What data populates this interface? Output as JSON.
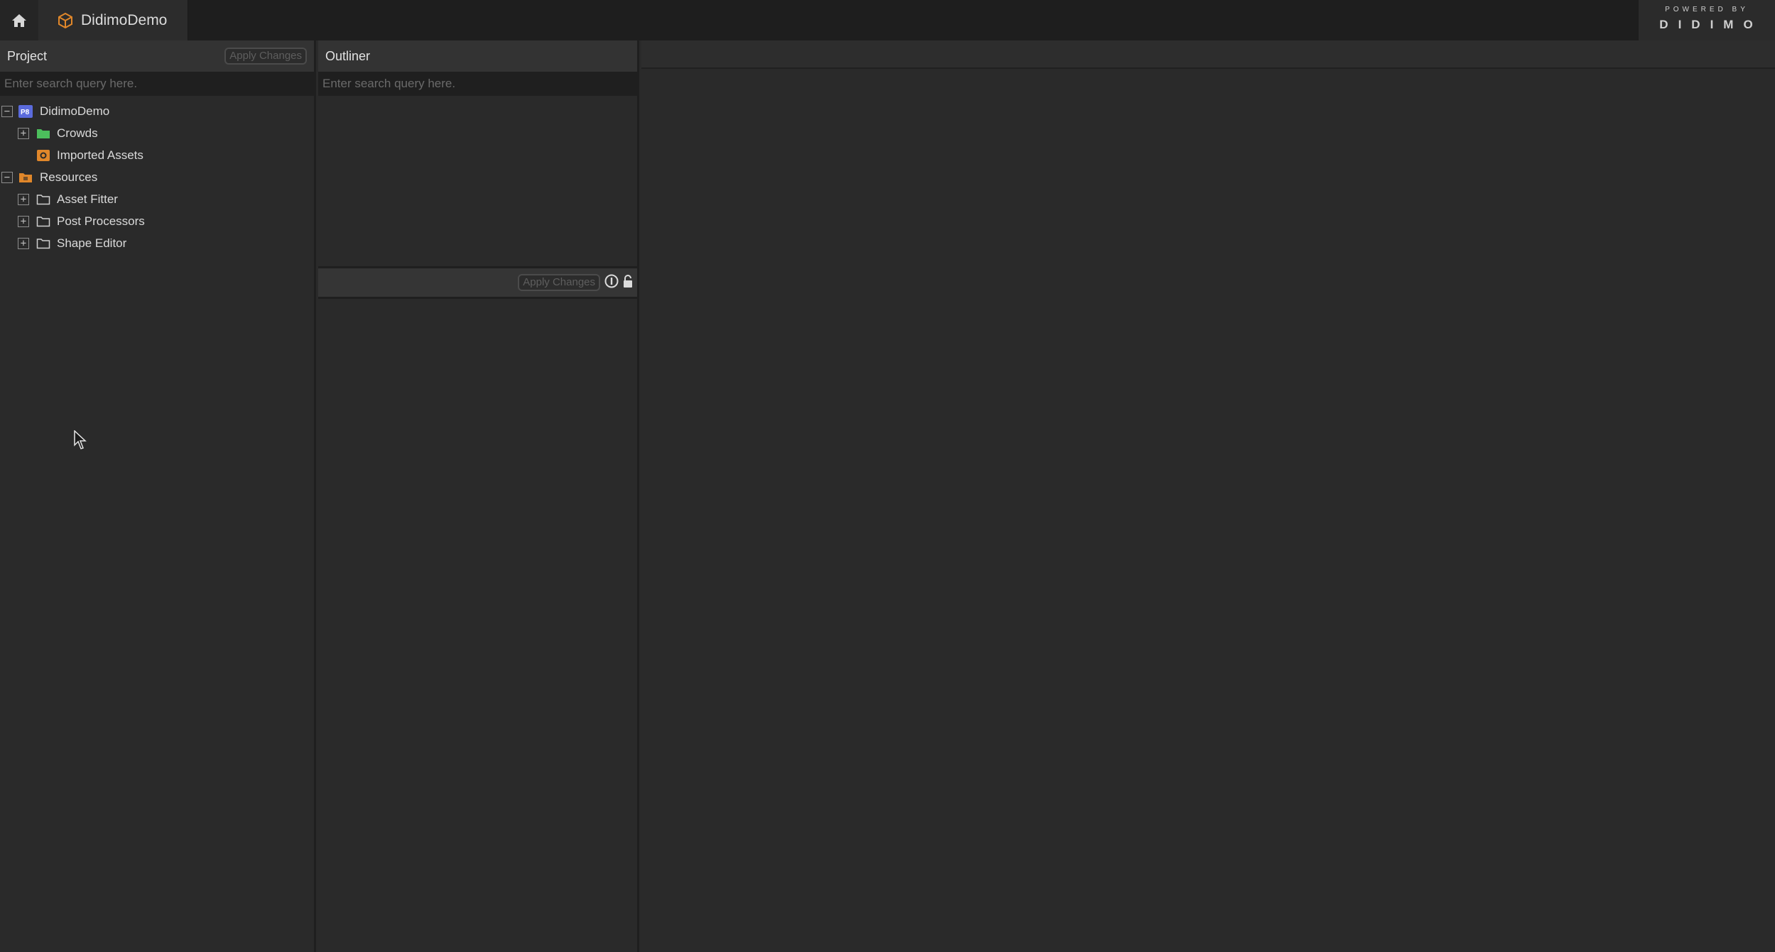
{
  "topbar": {
    "tab_title": "DidimoDemo",
    "brand_small": "POWERED BY",
    "brand_logo": "DIDIMO"
  },
  "project": {
    "title": "Project",
    "apply_label": "Apply Changes",
    "search_placeholder": "Enter search query here.",
    "tree": [
      {
        "label": "DidimoDemo",
        "icon": "project-icon",
        "toggle": "−"
      },
      {
        "label": "Crowds",
        "icon": "green-folder-icon",
        "toggle": "+"
      },
      {
        "label": "Imported Assets",
        "icon": "imported-assets-icon"
      },
      {
        "label": "Resources",
        "icon": "orange-folder-icon",
        "toggle": "−"
      },
      {
        "label": "Asset Fitter",
        "icon": "folder-icon",
        "toggle": "+"
      },
      {
        "label": "Post Processors",
        "icon": "folder-icon",
        "toggle": "+"
      },
      {
        "label": "Shape Editor",
        "icon": "folder-icon",
        "toggle": "+"
      }
    ]
  },
  "outliner": {
    "title": "Outliner",
    "search_placeholder": "Enter search query here.",
    "apply_label": "Apply Changes"
  },
  "colors": {
    "project_icon": "#5b6bdc",
    "green_folder": "#4cbf5c",
    "orange": "#e0872a"
  }
}
